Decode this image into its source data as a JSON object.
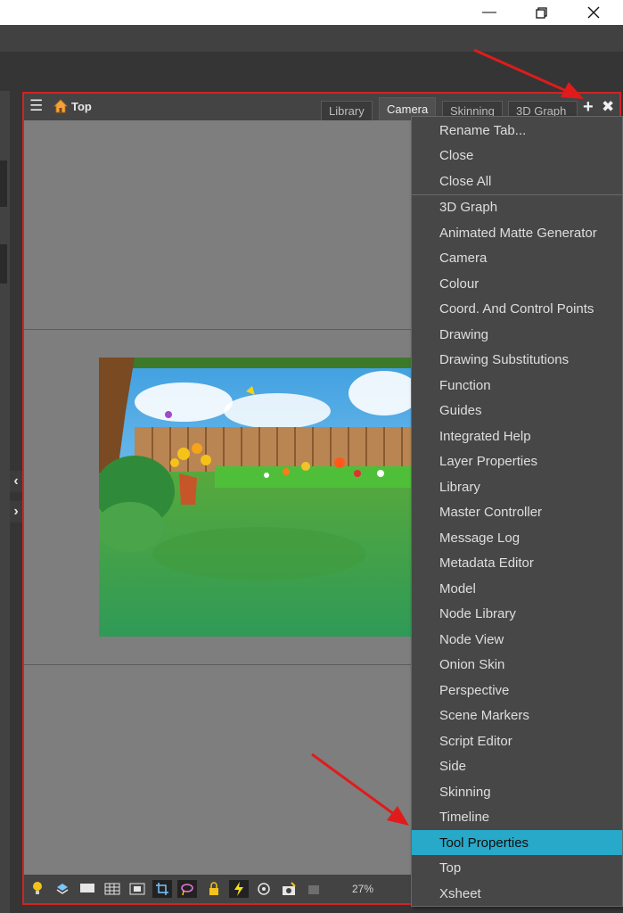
{
  "window": {
    "minimize_icon": "minimize-icon",
    "restore_icon": "restore-icon",
    "close_icon": "close-icon"
  },
  "panel": {
    "view_label": "Top",
    "tabs": [
      {
        "label": "Library",
        "active": false
      },
      {
        "label": "Camera",
        "active": true
      },
      {
        "label": "Skinning",
        "active": false
      },
      {
        "label": "3D Graph",
        "active": false
      }
    ]
  },
  "toolbar": {
    "zoom": "27%"
  },
  "menu": {
    "group1": [
      "Rename Tab...",
      "Close",
      "Close All"
    ],
    "group2": [
      "3D Graph",
      "Animated Matte Generator",
      "Camera",
      "Colour",
      "Coord. And Control Points",
      "Drawing",
      "Drawing Substitutions",
      "Function",
      "Guides",
      "Integrated Help",
      "Layer Properties",
      "Library",
      "Master Controller",
      "Message Log",
      "Metadata Editor",
      "Model",
      "Node Library",
      "Node View",
      "Onion Skin",
      "Perspective",
      "Scene Markers",
      "Script Editor",
      "Side",
      "Skinning",
      "Timeline",
      "Tool Properties",
      "Top",
      "Xsheet"
    ],
    "highlighted": "Tool Properties"
  },
  "colors": {
    "highlight": "#28a9c9",
    "annotation": "#e01b1b",
    "menu_bg": "#474747"
  }
}
